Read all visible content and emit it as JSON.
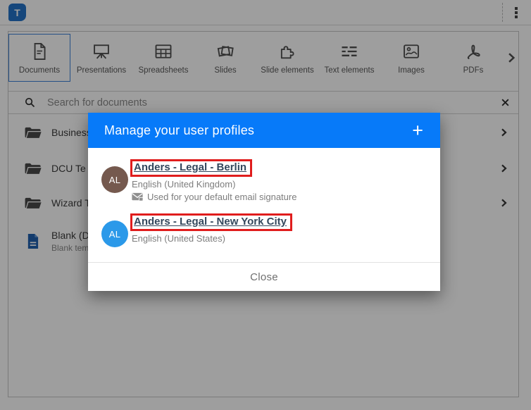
{
  "topbar": {
    "logo_letter": "T"
  },
  "tabs": {
    "items": [
      {
        "label": "Documents",
        "icon": "document-icon",
        "selected": true
      },
      {
        "label": "Presentations",
        "icon": "presentation-icon",
        "selected": false
      },
      {
        "label": "Spreadsheets",
        "icon": "spreadsheet-icon",
        "selected": false
      },
      {
        "label": "Slides",
        "icon": "slides-icon",
        "selected": false
      },
      {
        "label": "Slide elements",
        "icon": "puzzle-icon",
        "selected": false
      },
      {
        "label": "Text elements",
        "icon": "text-lines-icon",
        "selected": false
      },
      {
        "label": "Images",
        "icon": "image-icon",
        "selected": false
      },
      {
        "label": "PDFs",
        "icon": "pdf-icon",
        "selected": false
      }
    ]
  },
  "search": {
    "placeholder": "Search for documents"
  },
  "document_list": {
    "rows": [
      {
        "type": "folder",
        "label": "Business"
      },
      {
        "type": "folder",
        "label": "DCU Te"
      },
      {
        "type": "folder",
        "label": "Wizard T"
      },
      {
        "type": "document",
        "label": "Blank (D",
        "sublabel": "Blank tem"
      }
    ]
  },
  "modal": {
    "title": "Manage your user profiles",
    "add_label": "+",
    "profiles": [
      {
        "initials": "AL",
        "avatar_color": "#75594e",
        "name": "Anders - Legal - Berlin",
        "language": "English (United Kingdom)",
        "note": "Used for your default email signature"
      },
      {
        "initials": "AL",
        "avatar_color": "#2b99e9",
        "name": "Anders - Legal - New York City",
        "language": "English (United States)"
      }
    ],
    "close_label": "Close"
  },
  "colors": {
    "modal_header_blue": "#077af9",
    "annotation_red": "#e01d1d",
    "selected_tab_border": "#3c82d8"
  }
}
